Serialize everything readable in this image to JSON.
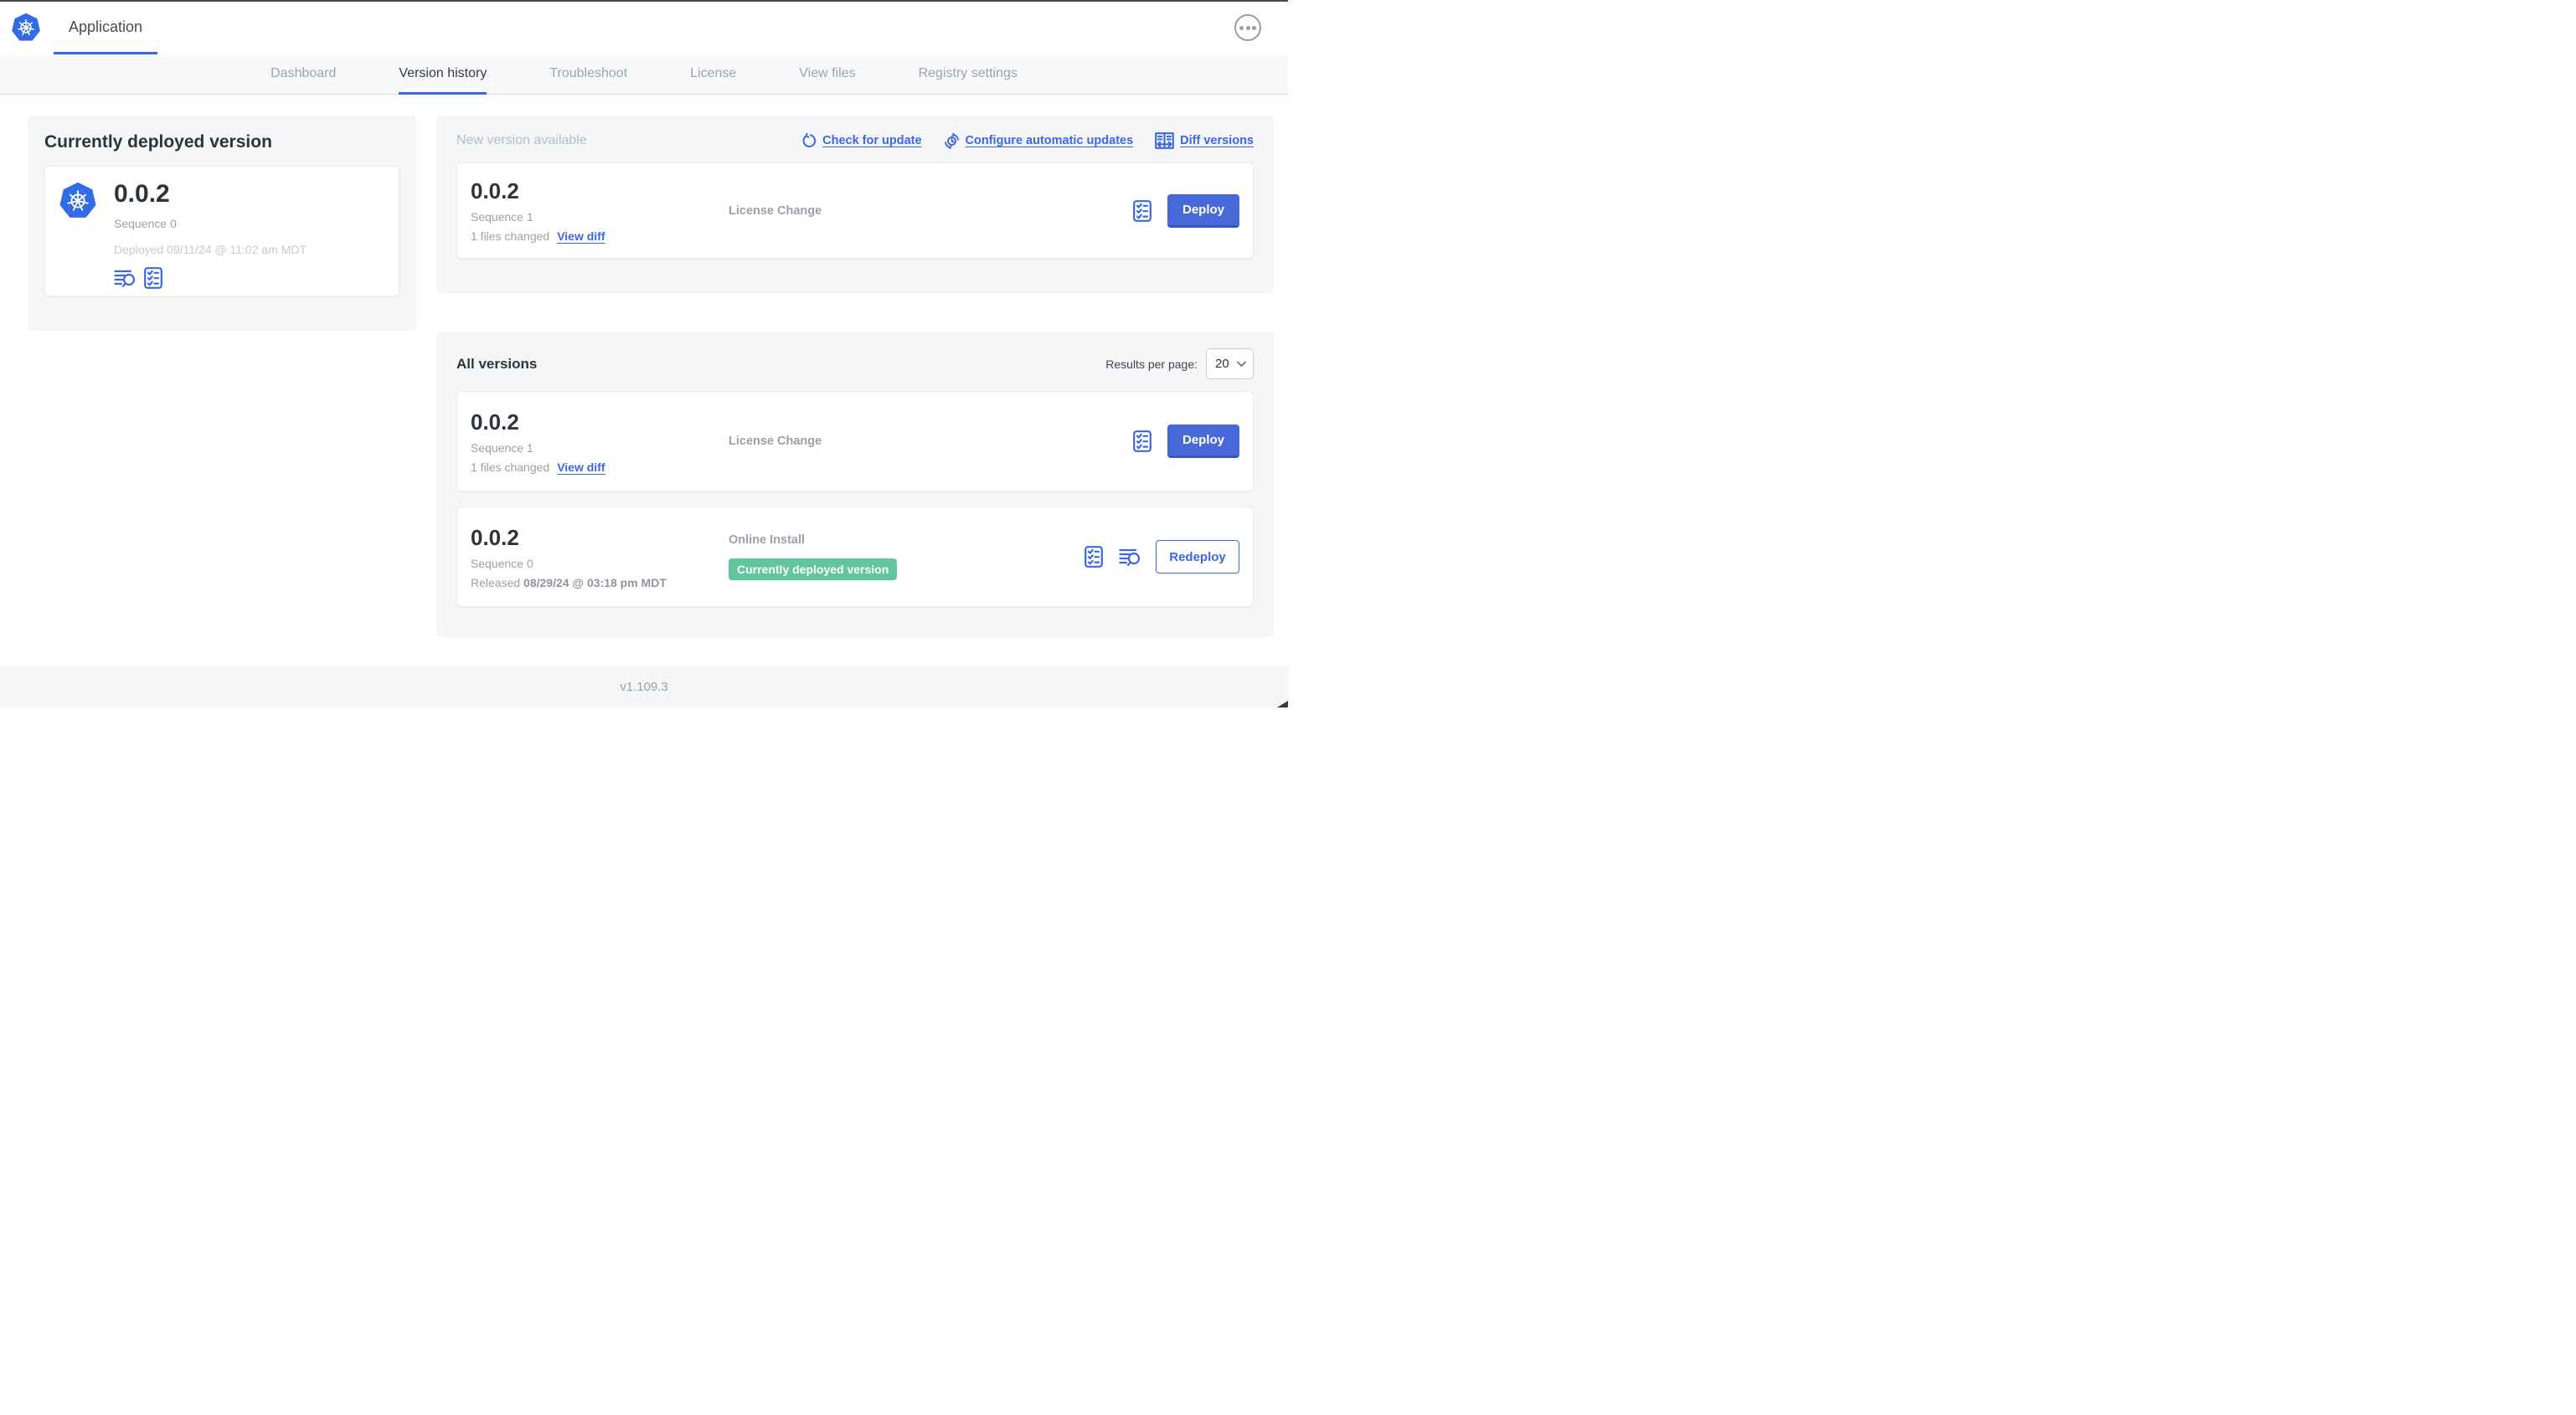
{
  "colors": {
    "primary_blue": "#3b67e2",
    "button_blue": "#4769d8",
    "badge_green": "#61c69b",
    "panel_gray": "#f5f6f8",
    "k8s_logo_blue": "#326ce5"
  },
  "header": {
    "app_title": "Application",
    "menu_icon": "ellipsis-icon",
    "logo_icon": "kubernetes-logo"
  },
  "tabs": {
    "active": "Version history",
    "items": [
      {
        "label": "Dashboard"
      },
      {
        "label": "Version history"
      },
      {
        "label": "Troubleshoot"
      },
      {
        "label": "License"
      },
      {
        "label": "View files"
      },
      {
        "label": "Registry settings"
      }
    ]
  },
  "currently_deployed": {
    "heading": "Currently deployed version",
    "version": "0.0.2",
    "sequence": "Sequence 0",
    "deployed_at": "Deployed 09/11/24 @ 11:02 am MDT",
    "icons": [
      "logs-icon",
      "checklist-icon"
    ]
  },
  "new_version": {
    "heading": "New version available",
    "links": [
      {
        "label": "Check for update",
        "icon": "refresh-icon"
      },
      {
        "label": "Configure automatic updates",
        "icon": "auto-update-icon"
      },
      {
        "label": "Diff versions",
        "icon": "diff-icon"
      }
    ],
    "card": {
      "version": "0.0.2",
      "sequence": "Sequence 1",
      "files_changed": "1 files changed",
      "view_diff_label": "View diff",
      "source": "License Change",
      "deploy_label": "Deploy",
      "icons": [
        "checklist-icon"
      ]
    }
  },
  "all_versions": {
    "heading": "All versions",
    "results_per_page_label": "Results per page:",
    "results_per_page_value": "20",
    "rows": [
      {
        "version": "0.0.2",
        "sequence": "Sequence 1",
        "files_changed": "1 files changed",
        "view_diff_label": "View diff",
        "source": "License Change",
        "action_label": "Deploy",
        "icons": [
          "checklist-icon"
        ]
      },
      {
        "version": "0.0.2",
        "sequence": "Sequence 0",
        "released_prefix": "Released ",
        "released_date": "08/29/24 @ 03:18 pm MDT",
        "source": "Online Install",
        "badge": "Currently deployed version",
        "action_label": "Redeploy",
        "icons": [
          "checklist-icon",
          "logs-icon"
        ]
      }
    ]
  },
  "footer": {
    "version": "v1.109.3"
  }
}
